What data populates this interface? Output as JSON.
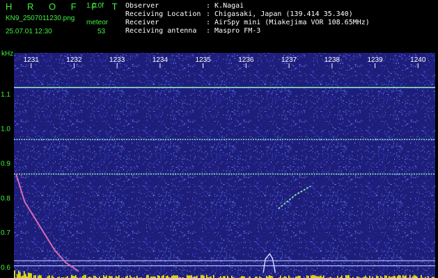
{
  "header": {
    "title": "H R O F F T",
    "version": "1.0.0f",
    "filename": "KN9_2507011230.png",
    "label": "meteor",
    "datetime": "25.07.01 12:30",
    "count": "53",
    "meta": [
      {
        "key": "Observer",
        "value": ": K.Nagai"
      },
      {
        "key": "Receiving Location",
        "value": ": Chigasaki, Japan (139.414 35.340)"
      },
      {
        "key": "Receiver",
        "value": ": AirSpy mini (Miakejima VOR 108.65MHz)"
      },
      {
        "key": "Receiving antenna",
        "value": ": Maspro FM-3"
      }
    ]
  },
  "colors": {
    "text_green": "#3ff33f",
    "background": "#1e1e7a",
    "carrier": "#8fe6c0",
    "meteor": "#d86ab0",
    "marker_line": "#cfd6ff",
    "baseline": "#ffff00"
  },
  "chart_data": {
    "type": "heatmap",
    "title": "",
    "xlabel": "",
    "ylabel": "kHz",
    "x_ticks": [
      "1231",
      "1232",
      "1233",
      "1234",
      "1235",
      "1236",
      "1237",
      "1238",
      "1239",
      "1240"
    ],
    "x_range": [
      1230.6,
      1240.4
    ],
    "y_ticks": [
      0.6,
      0.7,
      0.8,
      0.9,
      1.0,
      1.1
    ],
    "y_range": [
      0.57,
      1.22
    ],
    "grid": false,
    "carriers": [
      {
        "freq": 1.12,
        "style": "solid"
      },
      {
        "freq": 0.97,
        "style": "dashed"
      },
      {
        "freq": 0.87,
        "style": "dashed"
      }
    ],
    "marker_lines": [
      0.62,
      0.605
    ],
    "echoes": [
      {
        "kind": "descending",
        "points": [
          [
            1230.65,
            0.87
          ],
          [
            1230.85,
            0.79
          ],
          [
            1231.0,
            0.76
          ],
          [
            1231.25,
            0.71
          ],
          [
            1231.55,
            0.65
          ],
          [
            1231.8,
            0.615
          ],
          [
            1232.1,
            0.59
          ]
        ]
      },
      {
        "kind": "hump",
        "points": [
          [
            1236.4,
            0.585
          ],
          [
            1236.45,
            0.625
          ],
          [
            1236.55,
            0.64
          ],
          [
            1236.62,
            0.625
          ],
          [
            1236.68,
            0.585
          ]
        ]
      },
      {
        "kind": "rising",
        "points": [
          [
            1236.75,
            0.77
          ],
          [
            1237.15,
            0.81
          ],
          [
            1237.5,
            0.835
          ]
        ]
      }
    ],
    "baseline": {
      "level": 0.575
    }
  }
}
